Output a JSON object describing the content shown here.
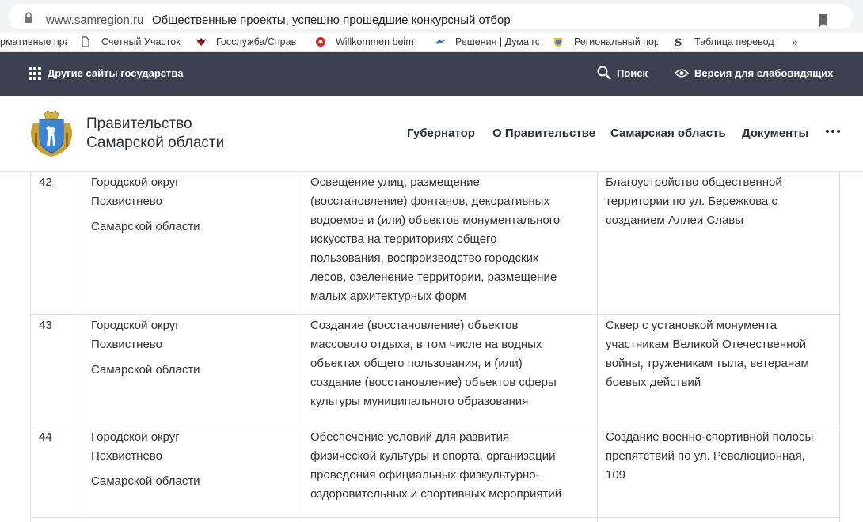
{
  "browser": {
    "domain": "www.samregion.ru",
    "page_title": "Общественные проекты, успешно прошедшие конкурсный отбор"
  },
  "bookmarks": {
    "items": [
      {
        "label": "рмативные пра",
        "icon": "none"
      },
      {
        "label": "Счетный Участок",
        "icon": "document-icon"
      },
      {
        "label": "Госслужба/Справ",
        "icon": "eagle-emblem-icon"
      },
      {
        "label": "Willkommen beim",
        "icon": "red-emblem-icon"
      },
      {
        "label": "Решения | Дума го",
        "icon": "bird-logo-icon"
      },
      {
        "label": "Региональный пор",
        "icon": "regional-emblem-icon"
      },
      {
        "label": "Таблица перевод",
        "icon": "s-logo-icon"
      }
    ],
    "overflow": "»"
  },
  "top_bar": {
    "other_sites": "Другие сайты государства",
    "search": "Поиск",
    "accessible_version": "Версия для слабовидящих"
  },
  "header": {
    "org_line1": "Правительство",
    "org_line2": "Самарской области",
    "nav": [
      "Губернатор",
      "О Правительстве",
      "Самарская область",
      "Документы"
    ]
  },
  "table": {
    "rows": [
      {
        "num": "42",
        "municipality_line1": "Городской округ",
        "municipality_line2": "Похвистнево",
        "municipality_line3": "Самарской области",
        "category_lines": [
          "Освещение улиц, размещение",
          "(восстановление) фонтанов, декоративных",
          "водоемов и (или) объектов монументального",
          "искусства на территориях общего",
          "пользования, воспроизводство городских",
          "лесов, озеленение территории, размещение",
          "малых архитектурных форм"
        ],
        "project_lines": [
          "Благоустройство общественной",
          "территории по ул. Бережкова с",
          "созданием Аллеи Славы"
        ]
      },
      {
        "num": "43",
        "municipality_line1": "Городской округ",
        "municipality_line2": "Похвистнево",
        "municipality_line3": "Самарской области",
        "category_lines": [
          "Создание (восстановление) объектов",
          "массового отдыха, в том числе на водных",
          "объектах общего пользования, и (или)",
          "создание (восстановление) объектов сферы",
          "культуры муниципального образования"
        ],
        "project_lines": [
          "Сквер с установкой монумента",
          "участникам Великой Отечественной",
          "войны, труженикам тыла, ветеранам",
          "боевых действий"
        ]
      },
      {
        "num": "44",
        "municipality_line1": "Городской округ",
        "municipality_line2": "Похвистнево",
        "municipality_line3": "Самарской области",
        "category_lines": [
          "Обеспечение условий для развития",
          "физической культуры и спорта, организации",
          "проведения официальных физкультурно-",
          "оздоровительных и спортивных мероприятий"
        ],
        "project_lines": [
          "Создание военно-спортивной полосы",
          "препятствий по ул. Революционная,",
          "109"
        ]
      }
    ]
  }
}
